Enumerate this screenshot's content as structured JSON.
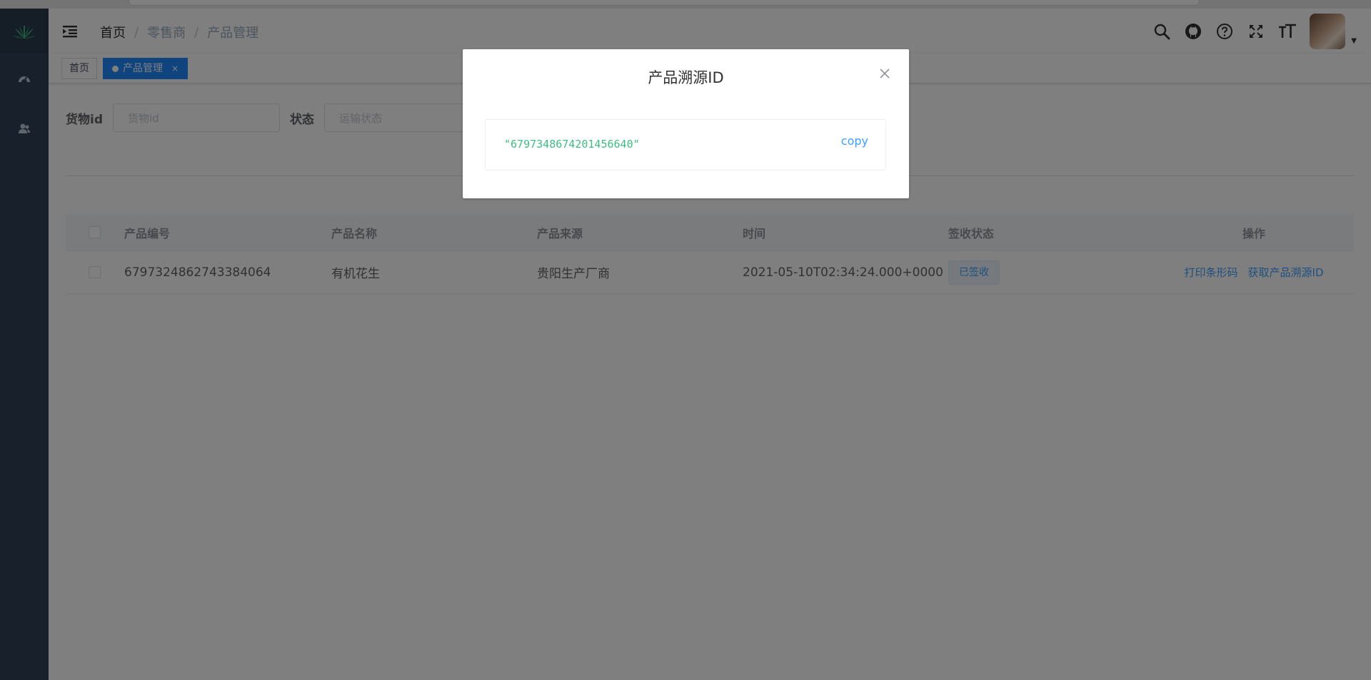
{
  "navbar": {
    "breadcrumb": [
      "首页",
      "零售商",
      "产品管理"
    ],
    "breadcrumb_sep": "/",
    "icons": [
      "search-icon",
      "github-icon",
      "help-icon",
      "fullscreen-icon",
      "font-size-icon"
    ]
  },
  "tags": {
    "home": "首页",
    "active": "产品管理",
    "close": "×"
  },
  "filter": {
    "cargo_label": "货物id",
    "cargo_placeholder": "货物id",
    "status_label": "状态",
    "status_placeholder": "运输状态"
  },
  "table": {
    "columns": [
      "产品编号",
      "产品名称",
      "产品来源",
      "时间",
      "签收状态",
      "操作"
    ],
    "rows": [
      {
        "id": "6797324862743384064",
        "name": "有机花生",
        "source": "贵阳生产厂商",
        "time": "2021-05-10T02:34:24.000+0000",
        "status": "已签收",
        "actions": [
          "打印条形码",
          "获取产品溯源ID"
        ]
      }
    ]
  },
  "dialog": {
    "title": "产品溯源ID",
    "code": "\"6797348674201456640\"",
    "copy_label": "copy"
  },
  "colors": {
    "sidebar": "#304156",
    "primary": "#1e88ff",
    "code": "#42b983"
  }
}
